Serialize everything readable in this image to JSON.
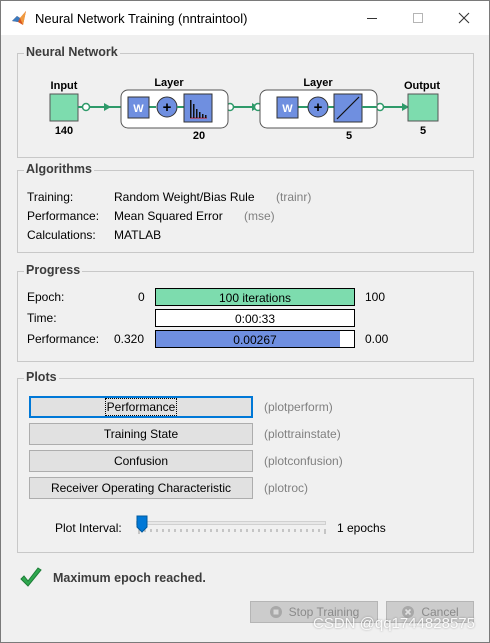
{
  "window": {
    "title": "Neural Network Training (nntraintool)",
    "controls": [
      "minimize",
      "maximize",
      "close"
    ]
  },
  "network": {
    "section_title": "Neural Network",
    "input_label": "Input",
    "input_size": "140",
    "layer1_label": "Layer",
    "layer1_size": "20",
    "layer2_label": "Layer",
    "layer2_size": "5",
    "output_label": "Output",
    "output_size": "5",
    "weight_symbol": "W",
    "sum_symbol": "+"
  },
  "algorithms": {
    "section_title": "Algorithms",
    "rows": [
      {
        "label": "Training:",
        "value": "Random Weight/Bias Rule",
        "fn": "(trainr)"
      },
      {
        "label": "Performance:",
        "value": "Mean Squared Error",
        "fn": "(mse)"
      },
      {
        "label": "Calculations:",
        "value": "MATLAB",
        "fn": ""
      }
    ]
  },
  "progress": {
    "section_title": "Progress",
    "epoch": {
      "label": "Epoch:",
      "min": "0",
      "text": "100 iterations",
      "max": "100",
      "fill": 1.0
    },
    "time": {
      "label": "Time:",
      "text": "0:00:33"
    },
    "performance": {
      "label": "Performance:",
      "min": "0.320",
      "text": "0.00267",
      "max": "0.00",
      "fill": 0.93
    }
  },
  "plots": {
    "section_title": "Plots",
    "buttons": [
      {
        "label": "Performance",
        "fn": "(plotperform)"
      },
      {
        "label": "Training State",
        "fn": "(plottrainstate)"
      },
      {
        "label": "Confusion",
        "fn": "(plotconfusion)"
      },
      {
        "label": "Receiver Operating Characteristic",
        "fn": "(plotroc)"
      }
    ],
    "interval_label": "Plot Interval:",
    "interval_value": "1 epochs"
  },
  "status": {
    "message": "Maximum epoch reached."
  },
  "actions": {
    "stop_label": "Stop Training",
    "cancel_label": "Cancel"
  },
  "watermark": "CSDN @qq1744828575",
  "colors": {
    "epoch_fill": "#7ddcae",
    "performance_fill": "#6f8fe0",
    "node_green": "#7ddcae",
    "block_blue": "#6f8fe0",
    "check_green": "#2fa84f"
  }
}
